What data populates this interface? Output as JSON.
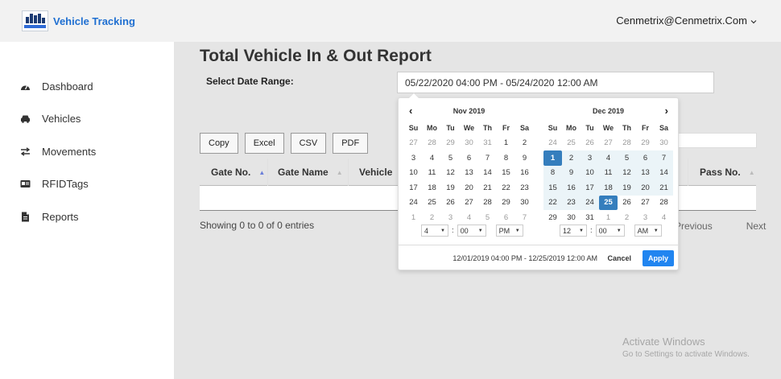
{
  "app": {
    "title": "Vehicle Tracking",
    "user": "Cenmetrix@Cenmetrix.Com"
  },
  "sidebar": {
    "items": [
      {
        "label": "Dashboard",
        "icon": "dashboard-icon"
      },
      {
        "label": "Vehicles",
        "icon": "car-icon"
      },
      {
        "label": "Movements",
        "icon": "swap-arrows-icon"
      },
      {
        "label": "RFIDTags",
        "icon": "id-card-icon"
      },
      {
        "label": "Reports",
        "icon": "file-icon"
      }
    ]
  },
  "page": {
    "title": "Total Vehicle In & Out Report",
    "date_label": "Select Date Range:",
    "date_value": "05/22/2020 04:00 PM - 05/24/2020 12:00 AM"
  },
  "toolbar": {
    "buttons": [
      "Copy",
      "Excel",
      "CSV",
      "PDF"
    ]
  },
  "table": {
    "columns": [
      "Gate No.",
      "Gate Name",
      "Vehicle",
      "Pass No."
    ],
    "info": "Showing 0 to 0 of 0 entries",
    "prev": "Previous",
    "next": "Next"
  },
  "datepicker": {
    "weekdays": [
      "Su",
      "Mo",
      "Tu",
      "We",
      "Th",
      "Fr",
      "Sa"
    ],
    "left": {
      "month": "Nov 2019",
      "days": [
        {
          "d": "27",
          "t": "off"
        },
        {
          "d": "28",
          "t": "off"
        },
        {
          "d": "29",
          "t": "off"
        },
        {
          "d": "30",
          "t": "off"
        },
        {
          "d": "31",
          "t": "off"
        },
        {
          "d": "1",
          "t": ""
        },
        {
          "d": "2",
          "t": ""
        },
        {
          "d": "3",
          "t": ""
        },
        {
          "d": "4",
          "t": ""
        },
        {
          "d": "5",
          "t": ""
        },
        {
          "d": "6",
          "t": ""
        },
        {
          "d": "7",
          "t": ""
        },
        {
          "d": "8",
          "t": ""
        },
        {
          "d": "9",
          "t": ""
        },
        {
          "d": "10",
          "t": ""
        },
        {
          "d": "11",
          "t": ""
        },
        {
          "d": "12",
          "t": ""
        },
        {
          "d": "13",
          "t": ""
        },
        {
          "d": "14",
          "t": ""
        },
        {
          "d": "15",
          "t": ""
        },
        {
          "d": "16",
          "t": ""
        },
        {
          "d": "17",
          "t": ""
        },
        {
          "d": "18",
          "t": ""
        },
        {
          "d": "19",
          "t": ""
        },
        {
          "d": "20",
          "t": ""
        },
        {
          "d": "21",
          "t": ""
        },
        {
          "d": "22",
          "t": ""
        },
        {
          "d": "23",
          "t": ""
        },
        {
          "d": "24",
          "t": ""
        },
        {
          "d": "25",
          "t": ""
        },
        {
          "d": "26",
          "t": ""
        },
        {
          "d": "27",
          "t": ""
        },
        {
          "d": "28",
          "t": ""
        },
        {
          "d": "29",
          "t": ""
        },
        {
          "d": "30",
          "t": ""
        },
        {
          "d": "1",
          "t": "off"
        },
        {
          "d": "2",
          "t": "off"
        },
        {
          "d": "3",
          "t": "off"
        },
        {
          "d": "4",
          "t": "off"
        },
        {
          "d": "5",
          "t": "off"
        },
        {
          "d": "6",
          "t": "off"
        },
        {
          "d": "7",
          "t": "off"
        }
      ],
      "time": {
        "hour": "4",
        "minute": "00",
        "ampm": "PM"
      }
    },
    "right": {
      "month": "Dec 2019",
      "days": [
        {
          "d": "24",
          "t": "off"
        },
        {
          "d": "25",
          "t": "off"
        },
        {
          "d": "26",
          "t": "off"
        },
        {
          "d": "27",
          "t": "off"
        },
        {
          "d": "28",
          "t": "off"
        },
        {
          "d": "29",
          "t": "off"
        },
        {
          "d": "30",
          "t": "off"
        },
        {
          "d": "1",
          "t": "sel"
        },
        {
          "d": "2",
          "t": "inr"
        },
        {
          "d": "3",
          "t": "inr"
        },
        {
          "d": "4",
          "t": "inr"
        },
        {
          "d": "5",
          "t": "inr"
        },
        {
          "d": "6",
          "t": "inr"
        },
        {
          "d": "7",
          "t": "inr"
        },
        {
          "d": "8",
          "t": "inr"
        },
        {
          "d": "9",
          "t": "inr"
        },
        {
          "d": "10",
          "t": "inr"
        },
        {
          "d": "11",
          "t": "inr"
        },
        {
          "d": "12",
          "t": "inr"
        },
        {
          "d": "13",
          "t": "inr"
        },
        {
          "d": "14",
          "t": "inr"
        },
        {
          "d": "15",
          "t": "inr"
        },
        {
          "d": "16",
          "t": "inr"
        },
        {
          "d": "17",
          "t": "inr"
        },
        {
          "d": "18",
          "t": "inr"
        },
        {
          "d": "19",
          "t": "inr"
        },
        {
          "d": "20",
          "t": "inr"
        },
        {
          "d": "21",
          "t": "inr"
        },
        {
          "d": "22",
          "t": "inr"
        },
        {
          "d": "23",
          "t": "inr"
        },
        {
          "d": "24",
          "t": "inr"
        },
        {
          "d": "25",
          "t": "sel"
        },
        {
          "d": "26",
          "t": ""
        },
        {
          "d": "27",
          "t": ""
        },
        {
          "d": "28",
          "t": ""
        },
        {
          "d": "29",
          "t": ""
        },
        {
          "d": "30",
          "t": ""
        },
        {
          "d": "31",
          "t": ""
        },
        {
          "d": "1",
          "t": "off"
        },
        {
          "d": "2",
          "t": "off"
        },
        {
          "d": "3",
          "t": "off"
        },
        {
          "d": "4",
          "t": "off"
        }
      ],
      "time": {
        "hour": "12",
        "minute": "00",
        "ampm": "AM"
      }
    },
    "range_text": "12/01/2019 04:00 PM - 12/25/2019 12:00 AM",
    "cancel": "Cancel",
    "apply": "Apply"
  },
  "watermark": {
    "line1": "Activate Windows",
    "line2": "Go to Settings to activate Windows."
  },
  "colors": {
    "brand": "#1f6fd1",
    "selected": "#357ebd",
    "in_range": "#ebf4f8",
    "apply": "#2185f0"
  }
}
